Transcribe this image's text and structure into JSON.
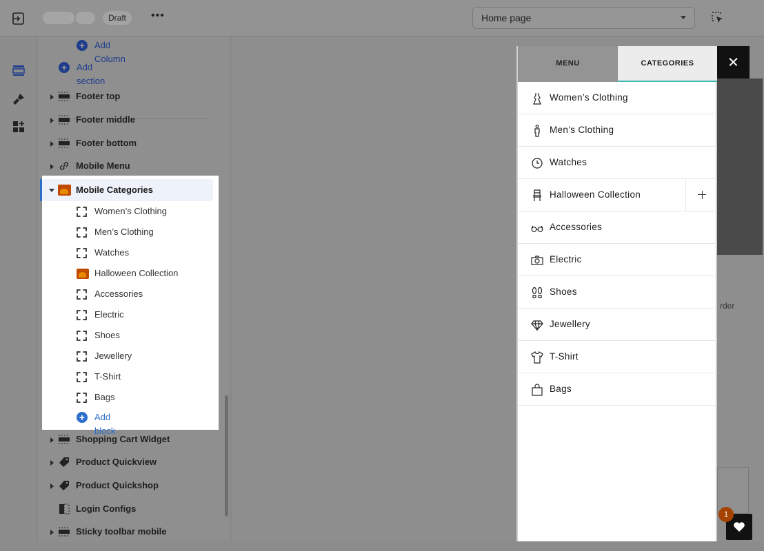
{
  "topbar": {
    "status_badge": "Draft",
    "more_label": "•••",
    "page_select": {
      "value": "Home page"
    }
  },
  "sidebar": {
    "add_column": "Add Column",
    "add_section": "Add section",
    "sections_before": [
      {
        "label": "Footer top",
        "icon": "section-layout-icon"
      },
      {
        "label": "Footer middle",
        "icon": "section-layout-icon"
      },
      {
        "label": "Footer bottom",
        "icon": "section-layout-icon"
      },
      {
        "label": "Mobile Menu",
        "icon": "link-icon"
      }
    ],
    "expanded_section": {
      "label": "Mobile Categories",
      "blocks": [
        {
          "label": "Women’s Clothing",
          "icon": "dashed-block-icon"
        },
        {
          "label": "Men’s Clothing",
          "icon": "dashed-block-icon"
        },
        {
          "label": "Watches",
          "icon": "dashed-block-icon"
        },
        {
          "label": "Halloween Collection",
          "icon": "image-thumbnail-icon"
        },
        {
          "label": "Accessories",
          "icon": "dashed-block-icon"
        },
        {
          "label": "Electric",
          "icon": "dashed-block-icon"
        },
        {
          "label": "Shoes",
          "icon": "dashed-block-icon"
        },
        {
          "label": "Jewellery",
          "icon": "dashed-block-icon"
        },
        {
          "label": "T-Shirt",
          "icon": "dashed-block-icon"
        },
        {
          "label": "Bags",
          "icon": "dashed-block-icon"
        }
      ],
      "add_block": "Add block"
    },
    "sections_after": [
      {
        "label": "Shopping Cart Widget",
        "icon": "section-layout-icon"
      },
      {
        "label": "Product Quickview",
        "icon": "tag-icon"
      },
      {
        "label": "Product Quickshop",
        "icon": "tag-icon"
      },
      {
        "label": "Login Configs",
        "icon": "sidebar-layout-icon"
      },
      {
        "label": "Sticky toolbar mobile",
        "icon": "section-layout-icon"
      }
    ]
  },
  "preview": {
    "tabs": {
      "menu": "MENU",
      "categories": "CATEGORIES"
    },
    "categories": [
      {
        "label": "Women’s Clothing",
        "icon": "dress-icon"
      },
      {
        "label": "Men’s Clothing",
        "icon": "man-icon"
      },
      {
        "label": "Watches",
        "icon": "clock-icon"
      },
      {
        "label": "Halloween Collection",
        "icon": "chair-icon",
        "expandable": true
      },
      {
        "label": "Accessories",
        "icon": "glasses-icon"
      },
      {
        "label": "Electric",
        "icon": "camera-icon"
      },
      {
        "label": "Shoes",
        "icon": "footprint-icon"
      },
      {
        "label": "Jewellery",
        "icon": "diamond-icon"
      },
      {
        "label": "T-Shirt",
        "icon": "tshirt-icon"
      },
      {
        "label": "Bags",
        "icon": "bag-icon"
      }
    ],
    "background_text": "rder",
    "cart_count": "1"
  },
  "colors": {
    "accent_blue": "#2c6ecb",
    "tab_underline": "#3fb6b2",
    "badge": "#a64200"
  }
}
